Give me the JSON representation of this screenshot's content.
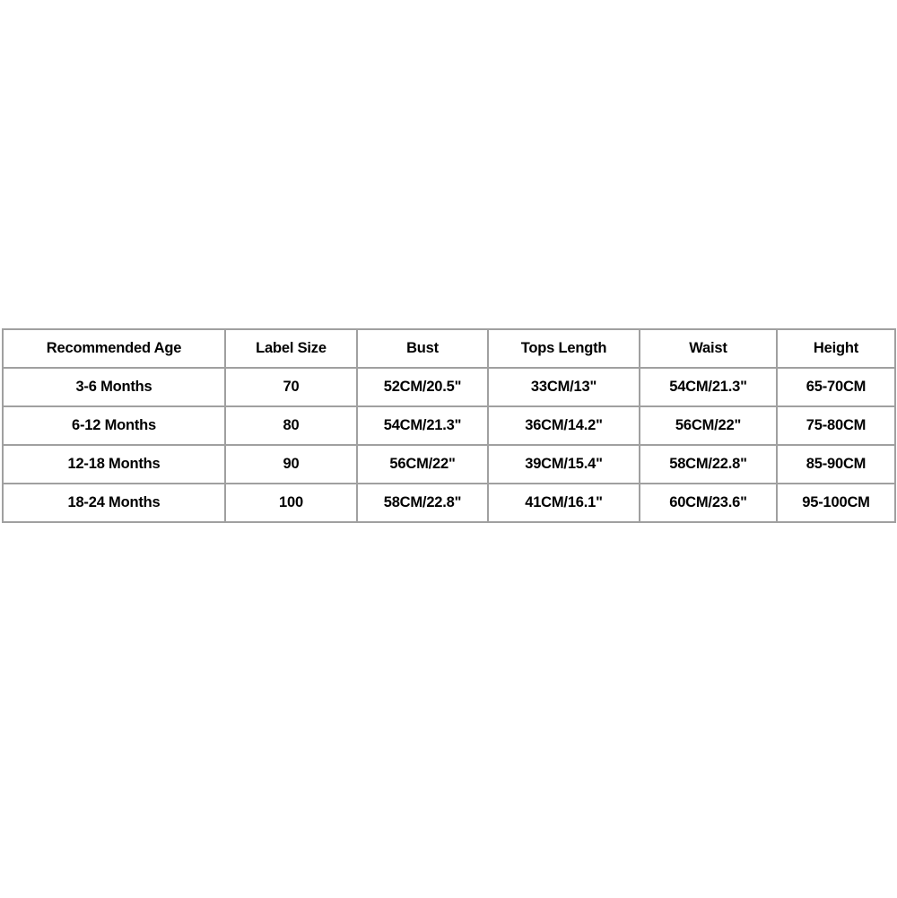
{
  "page": {
    "background_color": "#ffffff",
    "border_color": "#a0a0a0",
    "text_color": "#000000"
  },
  "table": {
    "title": "",
    "columns": [
      "Recommended Age",
      "Label Size",
      "Bust",
      "Tops Length",
      "Waist",
      "Height"
    ],
    "rows": [
      {
        "recommended_age": "3-6 Months",
        "label_size": "70",
        "bust": "52CM/20.5\"",
        "tops_length": "33CM/13\"",
        "waist": "54CM/21.3\"",
        "height": "65-70CM"
      },
      {
        "recommended_age": "6-12 Months",
        "label_size": "80",
        "bust": "54CM/21.3\"",
        "tops_length": "36CM/14.2\"",
        "waist": "56CM/22\"",
        "height": "75-80CM"
      },
      {
        "recommended_age": "12-18 Months",
        "label_size": "90",
        "bust": "56CM/22\"",
        "tops_length": "39CM/15.4\"",
        "waist": "58CM/22.8\"",
        "height": "85-90CM"
      },
      {
        "recommended_age": "18-24 Months",
        "label_size": "100",
        "bust": "58CM/22.8\"",
        "tops_length": "41CM/16.1\"",
        "waist": "60CM/23.6\"",
        "height": "95-100CM"
      }
    ]
  }
}
